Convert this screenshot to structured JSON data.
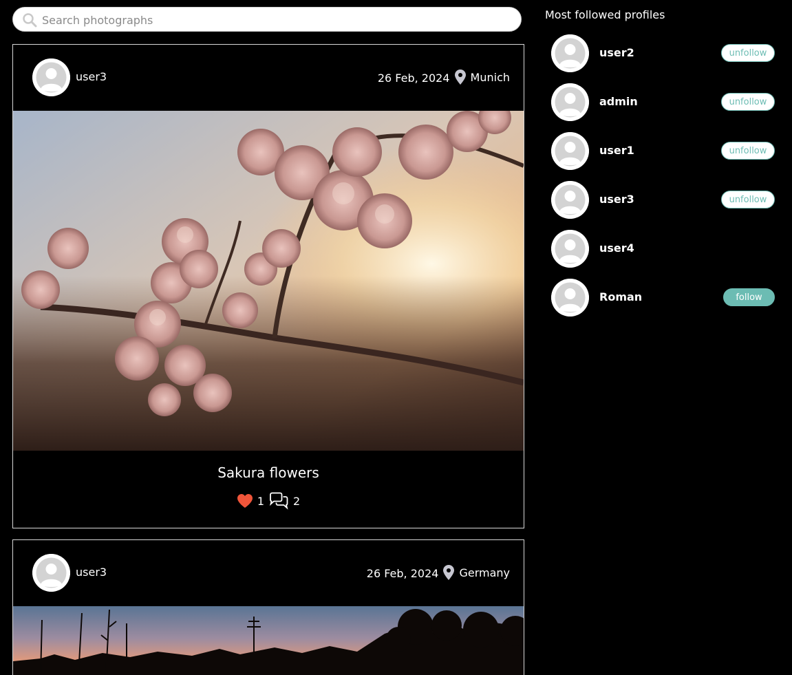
{
  "search": {
    "placeholder": "Search photographs",
    "value": ""
  },
  "posts": [
    {
      "username": "user3",
      "date": "26 Feb, 2024",
      "location": "Munich",
      "title": "Sakura flowers",
      "likes": "1",
      "comments": "2"
    },
    {
      "username": "user3",
      "date": "26 Feb, 2024",
      "location": "Germany"
    }
  ],
  "sidebar": {
    "title": "Most followed profiles",
    "profiles": [
      {
        "name": "user2",
        "button": "unfollow"
      },
      {
        "name": "admin",
        "button": "unfollow"
      },
      {
        "name": "user1",
        "button": "unfollow"
      },
      {
        "name": "user3",
        "button": "unfollow"
      },
      {
        "name": "user4",
        "button": ""
      },
      {
        "name": "Roman",
        "button": "follow"
      }
    ]
  },
  "colors": {
    "accent": "#6cbcb3",
    "heart": "#f0553a",
    "background": "#000000"
  },
  "icons": [
    "search-icon",
    "location-pin-icon",
    "heart-icon",
    "comment-icon",
    "avatar-placeholder-icon"
  ]
}
